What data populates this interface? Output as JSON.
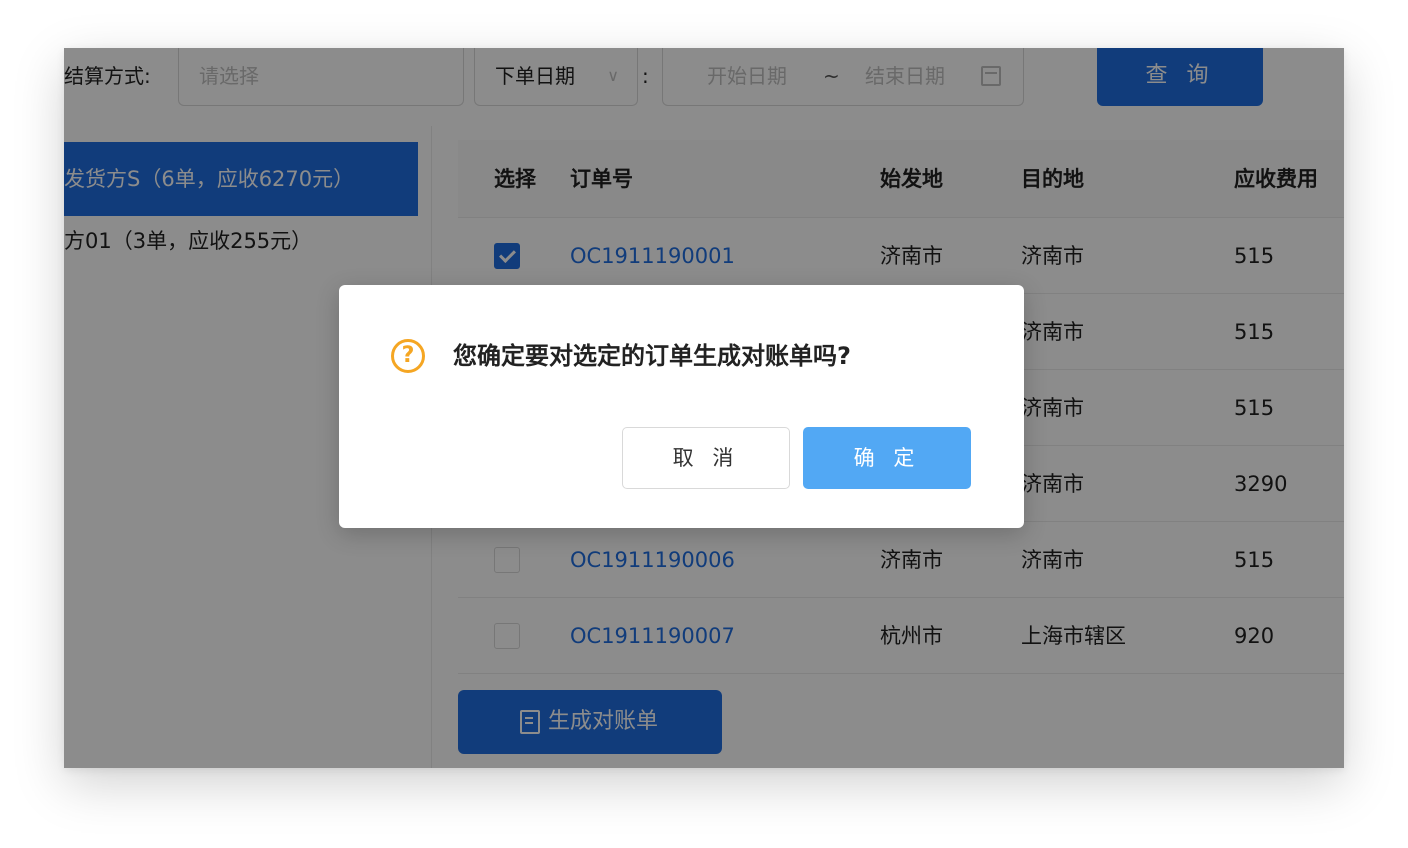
{
  "filters": {
    "settlement_label": "结算方式:",
    "settlement_placeholder": "请选择",
    "date_type": "下单日期",
    "colon": ":",
    "start_placeholder": "开始日期",
    "tilde": "~",
    "end_placeholder": "结束日期",
    "query_button": "查 询"
  },
  "parties": [
    {
      "label": "发货方S（6单，应收6270元）",
      "active": true
    },
    {
      "label": "方01（3单，应收255元）",
      "active": false
    }
  ],
  "table": {
    "headers": [
      "选择",
      "订单号",
      "始发地",
      "目的地",
      "应收费用"
    ],
    "rows": [
      {
        "checked": true,
        "order": "OC1911190001",
        "from": "济南市",
        "to": "济南市",
        "fee": "515"
      },
      {
        "checked": false,
        "order": "",
        "from": "",
        "to": "济南市",
        "fee": "515"
      },
      {
        "checked": false,
        "order": "",
        "from": "",
        "to": "济南市",
        "fee": "515"
      },
      {
        "checked": false,
        "order": "",
        "from": "",
        "to": "济南市",
        "fee": "3290"
      },
      {
        "checked": false,
        "order": "OC1911190006",
        "from": "济南市",
        "to": "济南市",
        "fee": "515"
      },
      {
        "checked": false,
        "order": "OC1911190007",
        "from": "杭州市",
        "to": "上海市辖区",
        "fee": "920"
      }
    ]
  },
  "generate_button": "生成对账单",
  "dialog": {
    "icon": "question-circle-icon",
    "title": "您确定要对选定的订单生成对账单吗?",
    "cancel": "取 消",
    "ok": "确 定"
  },
  "colors": {
    "primary": "#1f6ee0",
    "ok_button": "#52a8f4",
    "warning": "#f5a623"
  }
}
